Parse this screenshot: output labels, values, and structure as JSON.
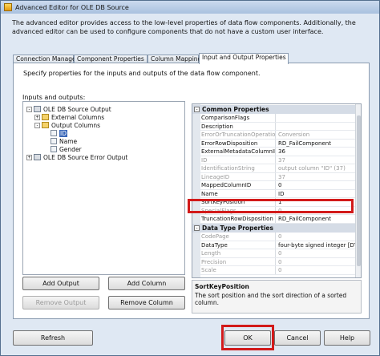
{
  "window": {
    "title": "Advanced Editor for OLE DB Source"
  },
  "intro": "The advanced editor provides access to the low-level properties of data flow components. Additionally, the advanced editor can be used to configure components that do not have a custom user interface.",
  "tabs": [
    {
      "label": "Connection Managers",
      "active": false
    },
    {
      "label": "Component Properties",
      "active": false
    },
    {
      "label": "Column Mappings",
      "active": false
    },
    {
      "label": "Input and Output Properties",
      "active": true
    }
  ],
  "panel": {
    "description": "Specify properties for the inputs and outputs of the data flow component.",
    "io_label": "Inputs and outputs:"
  },
  "tree": [
    {
      "expander": "-",
      "label": "OLE DB Source Output"
    },
    {
      "expander": "+",
      "label": "External Columns"
    },
    {
      "expander": "-",
      "label": "Output Columns"
    },
    {
      "expander": "",
      "label": "ID"
    },
    {
      "expander": "",
      "label": "Name"
    },
    {
      "expander": "",
      "label": "Gender"
    },
    {
      "expander": "+",
      "label": "OLE DB Source Error Output"
    }
  ],
  "buttons": {
    "add_output": "Add Output",
    "add_column": "Add Column",
    "remove_output": "Remove Output",
    "remove_column": "Remove Column",
    "refresh": "Refresh",
    "ok": "OK",
    "cancel": "Cancel",
    "help": "Help"
  },
  "properties": {
    "common_header": "Common Properties",
    "common": [
      {
        "name": "ComparisonFlags",
        "value": "",
        "readonly": false
      },
      {
        "name": "Description",
        "value": "",
        "readonly": false
      },
      {
        "name": "ErrorOrTruncationOperation",
        "value": "Conversion",
        "readonly": true
      },
      {
        "name": "ErrorRowDisposition",
        "value": "RD_FailComponent",
        "readonly": false
      },
      {
        "name": "ExternalMetadataColumnID",
        "value": "36",
        "readonly": false
      },
      {
        "name": "ID",
        "value": "37",
        "readonly": true
      },
      {
        "name": "IdentificationString",
        "value": "output column \"ID\" (37)",
        "readonly": true
      },
      {
        "name": "LineageID",
        "value": "37",
        "readonly": true
      },
      {
        "name": "MappedColumnID",
        "value": "0",
        "readonly": false
      },
      {
        "name": "Name",
        "value": "ID",
        "readonly": false
      },
      {
        "name": "SortKeyPosition",
        "value": "1",
        "readonly": false
      },
      {
        "name": "SpecialFlags",
        "value": "0",
        "readonly": true
      },
      {
        "name": "TruncationRowDisposition",
        "value": "RD_FailComponent",
        "readonly": false
      }
    ],
    "datatype_header": "Data Type Properties",
    "datatype": [
      {
        "name": "CodePage",
        "value": "0",
        "readonly": true
      },
      {
        "name": "DataType",
        "value": "four-byte signed integer [DT_I4]",
        "readonly": false
      },
      {
        "name": "Length",
        "value": "0",
        "readonly": true
      },
      {
        "name": "Precision",
        "value": "0",
        "readonly": true
      },
      {
        "name": "Scale",
        "value": "0",
        "readonly": true
      }
    ]
  },
  "description_box": {
    "title": "SortKeyPosition",
    "text": "The sort position and the sort direction of a sorted column."
  }
}
